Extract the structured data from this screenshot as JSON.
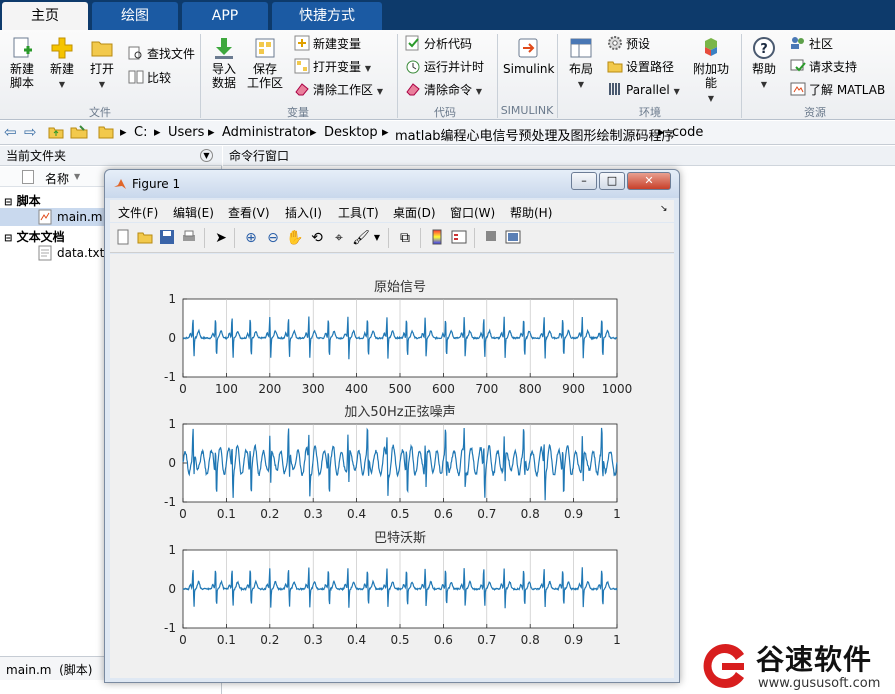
{
  "tabs": [
    {
      "label": "主页",
      "active": true
    },
    {
      "label": "绘图",
      "active": false
    },
    {
      "label": "APP",
      "active": false
    },
    {
      "label": "快捷方式",
      "active": false
    }
  ],
  "ribbon": {
    "file": {
      "new_script": "新建\n脚本",
      "new": "新建",
      "open": "打开",
      "find_files": "查找文件",
      "compare": "比较",
      "group": "文件"
    },
    "variable": {
      "import": "导入\n数据",
      "save_ws": "保存\n工作区",
      "new_var": "新建变量",
      "open_var": "打开变量",
      "clear_ws": "清除工作区",
      "group": "变量"
    },
    "code": {
      "analyze": "分析代码",
      "run_time": "运行并计时",
      "clear_cmd": "清除命令",
      "group": "代码"
    },
    "simulink": {
      "label": "Simulink",
      "group": "SIMULINK"
    },
    "env": {
      "layout": "布局",
      "prefs": "预设",
      "set_path": "设置路径",
      "parallel": "Parallel",
      "addons": "附加功能",
      "group": "环境"
    },
    "resources": {
      "help": "帮助",
      "community": "社区",
      "request_support": "请求支持",
      "learn": "了解 MATLAB",
      "group": "资源"
    }
  },
  "address": {
    "parts": [
      "C:",
      "Users",
      "Administrator",
      "Desktop",
      "matlab编程心电信号预处理及图形绘制源码程序",
      "code"
    ]
  },
  "left_panel": {
    "title": "当前文件夹",
    "col_name": "名称",
    "group_scripts": "脚本",
    "file_main": "main.m",
    "group_text": "文本文档",
    "file_data": "data.txt",
    "details": "main.m  (脚本)"
  },
  "command_window": {
    "title": "命令行窗口"
  },
  "figure": {
    "title": "Figure 1",
    "menu": [
      "文件(F)",
      "编辑(E)",
      "查看(V)",
      "插入(I)",
      "工具(T)",
      "桌面(D)",
      "窗口(W)",
      "帮助(H)"
    ],
    "line_color": "#1f77b4"
  },
  "chart_data": [
    {
      "type": "line",
      "title": "原始信号",
      "xlim": [
        0,
        1000
      ],
      "ylim": [
        -1,
        1
      ],
      "xticks": [
        0,
        100,
        200,
        300,
        400,
        500,
        600,
        700,
        800,
        900,
        1000
      ],
      "yticks": [
        -1,
        0,
        1
      ],
      "series": [
        {
          "values_description": "",
          "beats_x": [
            23,
            75,
            113,
            155,
            200,
            243,
            290,
            335,
            380,
            425,
            470,
            515,
            558,
            605,
            648,
            693,
            740,
            785,
            832,
            875,
            920,
            965
          ],
          "peak": 0.55,
          "trough": -0.55
        }
      ],
      "grid": "vertical"
    },
    {
      "type": "line",
      "title": "加入50Hz正弦噪声",
      "xlim": [
        0,
        1
      ],
      "ylim": [
        -1,
        1
      ],
      "xticks": [
        0,
        0.1,
        0.2,
        0.3,
        0.4,
        0.5,
        0.6,
        0.7,
        0.8,
        0.9,
        1
      ],
      "yticks": [
        -1,
        0,
        1
      ],
      "series": [
        {
          "beats_x": [
            0.023,
            0.075,
            0.113,
            0.155,
            0.2,
            0.243,
            0.29,
            0.335,
            0.38,
            0.425,
            0.47,
            0.515,
            0.558,
            0.605,
            0.648,
            0.693,
            0.74,
            0.785,
            0.832,
            0.875,
            0.92,
            0.965
          ],
          "peak": 0.7,
          "trough": -0.7,
          "noise_amp": 0.3
        }
      ],
      "grid": "vertical"
    },
    {
      "type": "line",
      "title": "巴特沃斯",
      "xlim": [
        0,
        1
      ],
      "ylim": [
        -1,
        1
      ],
      "xticks": [
        0,
        0.1,
        0.2,
        0.3,
        0.4,
        0.5,
        0.6,
        0.7,
        0.8,
        0.9,
        1
      ],
      "yticks": [
        -1,
        0,
        1
      ],
      "series": [
        {
          "beats_x": [
            0.023,
            0.075,
            0.113,
            0.155,
            0.2,
            0.243,
            0.29,
            0.335,
            0.38,
            0.425,
            0.47,
            0.515,
            0.558,
            0.605,
            0.648,
            0.693,
            0.74,
            0.785,
            0.832,
            0.875,
            0.92,
            0.965
          ],
          "peak": 0.55,
          "trough": -0.5
        }
      ],
      "grid": "vertical"
    }
  ],
  "watermark": {
    "brand": "谷速软件",
    "url": "www.gususoft.com",
    "color": "#d81e1e"
  }
}
